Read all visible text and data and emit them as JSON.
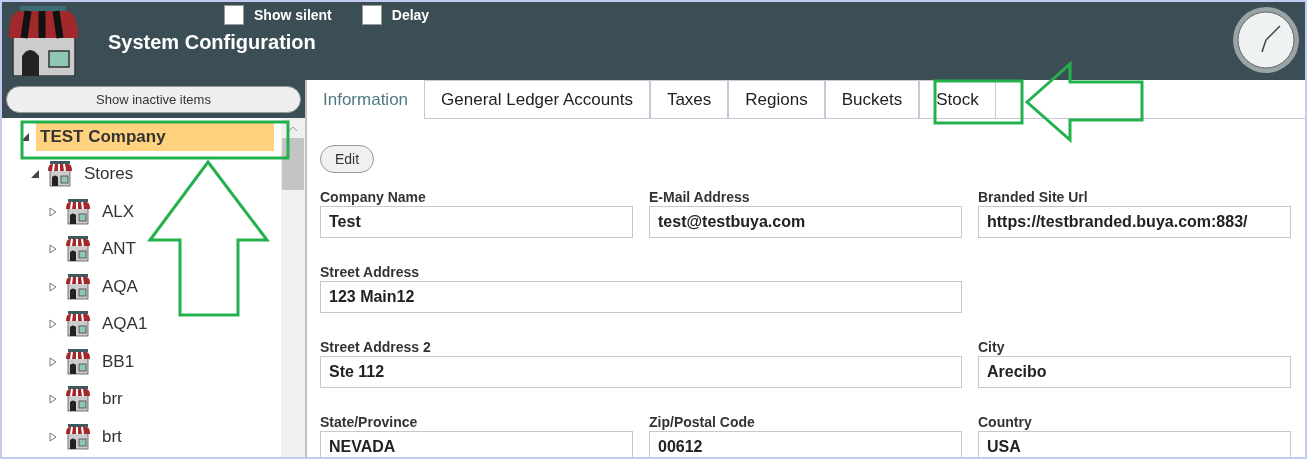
{
  "header": {
    "title": "System Configuration",
    "options": [
      {
        "label": "Show silent",
        "checked": false
      },
      {
        "label": "Delay",
        "checked": false
      }
    ]
  },
  "sidebar": {
    "button": "Show inactive items",
    "tree": [
      {
        "label": "TEST Company",
        "selected": true,
        "expanded": true,
        "children": [
          {
            "label": "Stores",
            "selected": false,
            "expanded": true,
            "kind": "store",
            "children": [
              {
                "label": "ALX",
                "selected": false,
                "expanded": false,
                "kind": "store"
              },
              {
                "label": "ANT",
                "selected": false,
                "expanded": false,
                "kind": "store"
              },
              {
                "label": "AQA",
                "selected": false,
                "expanded": false,
                "kind": "store"
              },
              {
                "label": "AQA1",
                "selected": false,
                "expanded": false,
                "kind": "store"
              },
              {
                "label": "BB1",
                "selected": false,
                "expanded": false,
                "kind": "store"
              },
              {
                "label": "brr",
                "selected": false,
                "expanded": false,
                "kind": "store"
              },
              {
                "label": "brt",
                "selected": false,
                "expanded": false,
                "kind": "store"
              }
            ]
          }
        ]
      }
    ]
  },
  "tabs": [
    {
      "label": "Information",
      "selected": true
    },
    {
      "label": "General Ledger Accounts",
      "selected": false
    },
    {
      "label": "Taxes",
      "selected": false
    },
    {
      "label": "Regions",
      "selected": false
    },
    {
      "label": "Buckets",
      "selected": false
    },
    {
      "label": "Stock",
      "selected": false
    }
  ],
  "edit_button": "Edit",
  "form": [
    [
      {
        "label": "Company Name",
        "value": "Test",
        "kind": "field"
      },
      {
        "label": "E-Mail Address",
        "value": "test@testbuya.com",
        "kind": "field"
      },
      {
        "label": "Branded Site Url",
        "value": "https://testbranded.buya.com:883/",
        "kind": "field"
      }
    ],
    [
      {
        "label": "Street Address",
        "value": "123 Main12",
        "kind": "wide_field"
      }
    ],
    [
      {
        "label": "Street Address 2",
        "value": "Ste 112",
        "kind": "wide_field"
      },
      {
        "label": "City",
        "value": "Arecibo",
        "kind": "field"
      }
    ],
    [
      {
        "label": "State/Province",
        "value": "NEVADA",
        "kind": "field"
      },
      {
        "label": "Zip/Postal Code",
        "value": "00612",
        "kind": "field"
      },
      {
        "label": "Country",
        "value": "USA",
        "kind": "field"
      }
    ]
  ]
}
